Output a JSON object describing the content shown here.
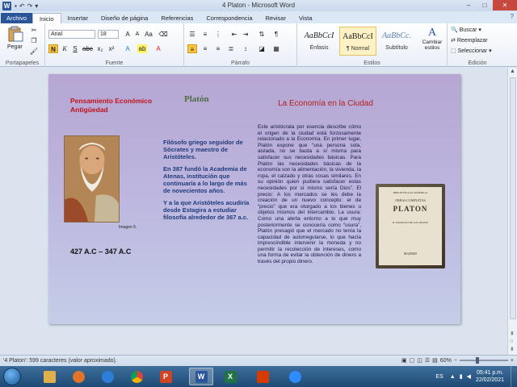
{
  "window": {
    "title": "4 Platon - Microsoft Word",
    "app_icon": "W",
    "controls": [
      "–",
      "□",
      "✕"
    ]
  },
  "tabs": [
    {
      "label": "Archivo"
    },
    {
      "label": "Inicio"
    },
    {
      "label": "Insertar"
    },
    {
      "label": "Diseño de página"
    },
    {
      "label": "Referencias"
    },
    {
      "label": "Correspondencia"
    },
    {
      "label": "Revisar"
    },
    {
      "label": "Vista"
    }
  ],
  "ribbon": {
    "clipboard": {
      "paste_label": "Pegar",
      "group_label": "Portapapeles"
    },
    "font": {
      "name": "Arial",
      "size": "18",
      "group_label": "Fuente"
    },
    "paragraph": {
      "group_label": "Párrafo"
    },
    "styles": {
      "group_label": "Estilos",
      "items": [
        {
          "sample": "AaBbCcI",
          "name": "Énfasis"
        },
        {
          "sample": "AaBbCcI",
          "name": "¶ Normal"
        },
        {
          "sample": "AaBbCc.",
          "name": "Subtítulo"
        }
      ],
      "change_label": "Cambiar estilos"
    },
    "editing": {
      "group_label": "Edición",
      "find": "Buscar",
      "replace": "Reemplazar",
      "select": "Seleccionar"
    }
  },
  "document": {
    "econ_left": "Pensamiento Económico Antigüedad",
    "platon_title": "Platón",
    "econ_city": "La Economía en la Ciudad",
    "image_caption": "Imagen 5.",
    "dates": "427 A.C – 347 A.C",
    "mid_paragraphs": [
      "Filósofo griego seguidor de Sócrates y maestro de Aristóteles.",
      " En 387 fundó la Academia de Atenas, institución que continuaría a lo largo de más de novecientos años.",
      "Y a la que Aristóteles acudiría desde Estagira a estudiar filosofía alrededor de 367 a.c."
    ],
    "right_text": "Este aristócrata por esencia describe cómo el origen de la ciudad está forzosamente relacionado a la Economía. En primer lugar, Platón expone que “una persona sola, aislada, no se basta a sí misma para satisfacer sus necesidades básicas. Para Platón las necesidades básicas de la economía son la alimentación, la vivienda, la ropa, el calzado y otras cosas similares. En su opinión quien pudiera satisfacer estas necesidades por sí mismo sería Dios”. El precio: A los mercados se les debe la creación de un nuevo concepto: el de “precio” que era otorgado a los bienes u objetos mismos del intercambio. La usura: Como una alerta entorno a lo que muy posteriormente se conocería como “usura”, Platón presagió que el mercado no tenía la capacidad de autorregularse, lo que hacía imprescindible intervenir la moneda y no permitir la recolección de intereses, como una forma de evitar la obtención de dinero a través del propio dinero.",
    "book": {
      "series": "BIBLIOTECA ECONÓMICA",
      "title_top": "OBRAS COMPLETAS",
      "title_main": "PLATON",
      "author": "D. PATRICIO DE AZCÁRATE",
      "place": "MADRID"
    }
  },
  "status": {
    "doc_info": "'4 Platon': 599 caracteres (valor aproximado).",
    "zoom": "60%"
  },
  "taskbar": {
    "lang": "ES",
    "time": "05:41 p.m.",
    "date": "22/02/2021"
  },
  "colors": {
    "accent": "#2a5699",
    "heading_red": "#c0121a",
    "body_blue": "#1f3a7a"
  }
}
